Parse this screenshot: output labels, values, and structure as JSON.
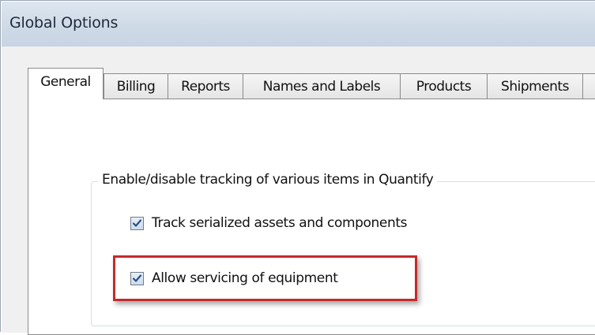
{
  "window": {
    "title": "Global Options"
  },
  "tabs": [
    {
      "label": "General",
      "active": true
    },
    {
      "label": "Billing",
      "active": false
    },
    {
      "label": "Reports",
      "active": false
    },
    {
      "label": "Names and Labels",
      "active": false
    },
    {
      "label": "Products",
      "active": false
    },
    {
      "label": "Shipments",
      "active": false
    }
  ],
  "tracking_group": {
    "legend": "Enable/disable tracking of various items in Quantify",
    "options": [
      {
        "label": "Track serialized assets and components",
        "checked": true
      },
      {
        "label": "Allow servicing of equipment",
        "checked": true,
        "highlighted": true
      }
    ]
  },
  "colors": {
    "highlight": "#c42a2a",
    "title_bar": "#cfdae7",
    "checkmark": "#2a4f87"
  },
  "icons": {
    "checkbox_check": "check-icon"
  }
}
